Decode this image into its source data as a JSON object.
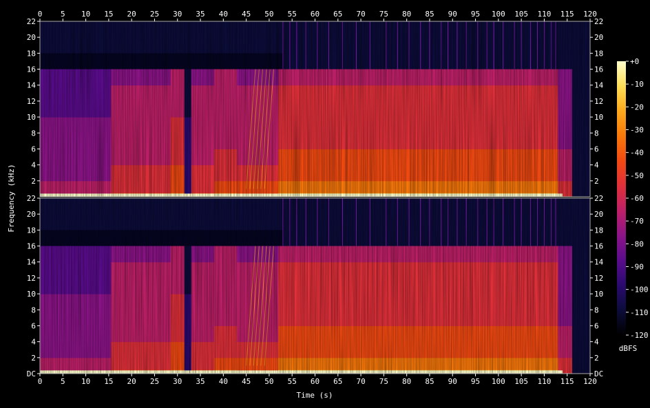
{
  "chart_data": {
    "type": "heatmap",
    "kind": "spectrogram",
    "channels": 2,
    "xlabel": "Time (s)",
    "ylabel": "Frequency (kHz)",
    "colorbar_label": "dBFS",
    "x_ticks": [
      "0",
      "5",
      "10",
      "15",
      "20",
      "25",
      "30",
      "35",
      "40",
      "45",
      "50",
      "55",
      "60",
      "65",
      "70",
      "75",
      "80",
      "85",
      "90",
      "95",
      "100",
      "105",
      "110",
      "115",
      "120"
    ],
    "x_tick_values": [
      0,
      5,
      10,
      15,
      20,
      25,
      30,
      35,
      40,
      45,
      50,
      55,
      60,
      65,
      70,
      75,
      80,
      85,
      90,
      95,
      100,
      105,
      110,
      115,
      120
    ],
    "xlim": [
      0,
      120
    ],
    "ylim_khz": [
      0,
      22
    ],
    "y_ticks_top": [
      "22",
      "20",
      "18",
      "16",
      "14",
      "12",
      "10",
      "8",
      "6",
      "4",
      "2"
    ],
    "y_ticks_bottom": [
      "22",
      "20",
      "18",
      "16",
      "14",
      "12",
      "10",
      "8",
      "6",
      "4",
      "2",
      "DC"
    ],
    "y_tick_values_top": [
      22,
      20,
      18,
      16,
      14,
      12,
      10,
      8,
      6,
      4,
      2
    ],
    "y_tick_values_bottom": [
      22,
      20,
      18,
      16,
      14,
      12,
      10,
      8,
      6,
      4,
      2,
      0
    ],
    "colorbar_ticks": [
      "+0",
      "-10",
      "-20",
      "-30",
      "-40",
      "-50",
      "-60",
      "-70",
      "-80",
      "-90",
      "-100",
      "-110",
      "-120"
    ],
    "colorbar_values": [
      0,
      -10,
      -20,
      -30,
      -40,
      -50,
      -60,
      -70,
      -80,
      -90,
      -100,
      -110,
      -120
    ],
    "colorbar_range_dbfs": [
      -120,
      0
    ],
    "lowpass_cutoff_khz": 16,
    "audio_end_s": 114,
    "colormap": [
      "#000000",
      "#0c0c3a",
      "#2a0a6e",
      "#5a0c8c",
      "#8c1488",
      "#be2068",
      "#e0303a",
      "#f24a12",
      "#f8780a",
      "#fca81c",
      "#fede56",
      "#ffffcc"
    ]
  }
}
